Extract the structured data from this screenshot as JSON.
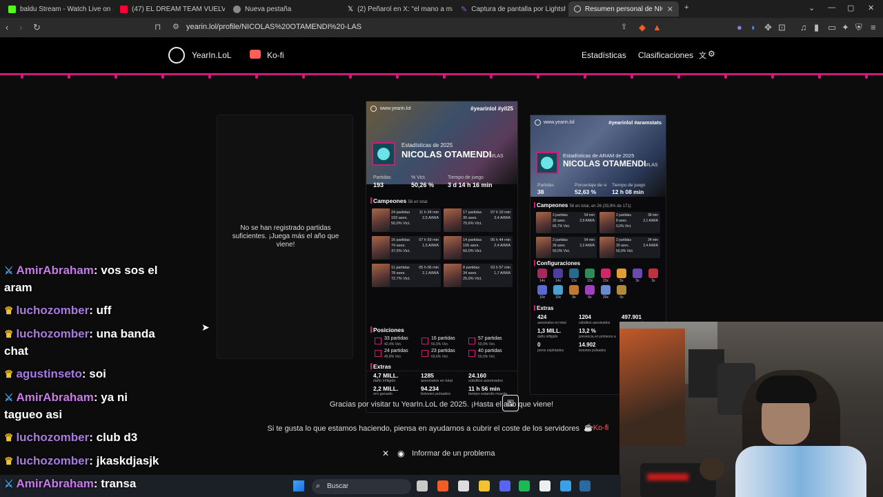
{
  "browser": {
    "tabs": [
      {
        "label": "baldu Stream - Watch Live on Ki",
        "favicon": "kick-icon",
        "color": "#53fc18"
      },
      {
        "label": "(47) EL DREAM TEAM VUELVE Y ALE",
        "favicon": "youtube-icon",
        "color": "#ff0033"
      },
      {
        "label": "Nueva pestaña",
        "favicon": "brave-icon",
        "color": "#999999"
      },
      {
        "label": "(2) Peñarol en X: \"el mano a mano",
        "favicon": "x-icon",
        "color": "#ffffff"
      },
      {
        "label": "Captura de pantalla por Lightshot",
        "favicon": "lightshot-icon",
        "color": "#a155e8"
      },
      {
        "label": "Resumen personal de NICOLAS",
        "favicon": "yearin-icon",
        "color": "#dddddd"
      }
    ],
    "url": "yearin.lol/profile/NICOLAS%20OTAMENDI%20-LAS"
  },
  "site": {
    "brand": "YearIn.LoL",
    "kofi": "Ko-fi",
    "nav": [
      "Estadísticas",
      "Clasificaciones"
    ],
    "empty_card_text": "No se han registrado partidas suficientes. ¡Juega más el año que viene!",
    "card1": {
      "site": "www.yearin.lol",
      "tags": "#yearinlol #yil25",
      "subtitle": "Estadísticas de 2025",
      "name": "NICOLAS OTAMENDI",
      "region": "#LAS",
      "stats": [
        {
          "label": "Partidas",
          "value": "193"
        },
        {
          "label": "% Vict.",
          "value": "50,26 %"
        },
        {
          "label": "Tiempo de juego",
          "value": "3 d 14 h 16 min"
        }
      ],
      "champions_title": "Campeones",
      "champions_note": "58 en total",
      "champions": [
        {
          "a": "24 partidas",
          "b": "193 ases.",
          "c": "50,0% Vict.",
          "d": "11 h 24 min",
          "e": "2,5 A/M/A"
        },
        {
          "a": "17 partidas",
          "b": "30 ases.",
          "c": "70,6% Vict.",
          "d": "07 h 10 min",
          "e": "3,4 A/M/A"
        },
        {
          "a": "16 partidas",
          "b": "74 ases.",
          "c": "37,5% Vict.",
          "d": "07 h 59 min",
          "e": "1,5 A/M/A"
        },
        {
          "a": "14 partidas",
          "b": "106 ases.",
          "c": "50,0% Vict.",
          "d": "06 h 44 min",
          "e": "2,4 A/M/A"
        },
        {
          "a": "11 partidas",
          "b": "78 ases.",
          "c": "72,7% Vict.",
          "d": "05 h 06 min",
          "e": "2,1 A/M/A"
        },
        {
          "a": "8 partidas",
          "b": "34 ases.",
          "c": "25,0% Vict.",
          "d": "03 h 57 min",
          "e": "1,7 A/M/A"
        }
      ],
      "positions_title": "Posiciones",
      "positions": [
        {
          "a": "33 partidas",
          "b": "42,4% Vict."
        },
        {
          "a": "16 partidas",
          "b": "50,0% Vict."
        },
        {
          "a": "57 partidas",
          "b": "50,9% Vict."
        },
        {
          "a": "24 partidas",
          "b": "45,8% Vict."
        },
        {
          "a": "23 partidas",
          "b": "69,6% Vict."
        },
        {
          "a": "40 partidas",
          "b": "50,0% Vict."
        }
      ],
      "extras_title": "Extras",
      "extras": [
        {
          "value": "4,7 MILL.",
          "label": "daño infligido"
        },
        {
          "value": "1285",
          "label": "asesinatos en total"
        },
        {
          "value": "24.160",
          "label": "súbditos asesinados"
        },
        {
          "value": "2,2 MILL.",
          "label": "oro ganado"
        },
        {
          "value": "94.234",
          "label": "botones pulsados"
        },
        {
          "value": "11 h 56 min",
          "label": "tiempo estando muerto"
        }
      ]
    },
    "card2": {
      "site": "www.yearin.lol",
      "tags": "#yearinlol #aramstats",
      "subtitle": "Estadísticas de ARAM de 2025",
      "name": "NICOLAS OTAMENDI",
      "region": "#LAS",
      "stats": [
        {
          "label": "Partidas",
          "value": "38"
        },
        {
          "label": "Porcentaje de vi",
          "value": "52,63 %"
        },
        {
          "label": "Tiempo de juego",
          "value": "12 h 08 min"
        }
      ],
      "champions_title": "Campeones",
      "champions_note": "58 en total, en 26 (33,9% de 171)",
      "champions": [
        {
          "a": "3 partidas",
          "b": "30 ases.",
          "c": "66,7% Vict.",
          "d": "54 min",
          "e": "2,9 A/M/A"
        },
        {
          "a": "2 partidas",
          "b": "8 ases.",
          "c": "0,0% Vict.",
          "d": "38 min",
          "e": "2,1 A/M/A"
        },
        {
          "a": "2 partidas",
          "b": "39 ases.",
          "c": "50,0% Vict.",
          "d": "54 min",
          "e": "2,2 A/M/A"
        },
        {
          "a": "2 partidas",
          "b": "30 ases.",
          "c": "50,0% Vict.",
          "d": "34 min",
          "e": "2,4 A/M/A"
        }
      ],
      "config_title": "Configuraciones",
      "configs": [
        "14x",
        "14x",
        "13x",
        "12x",
        "23x",
        "5x",
        "3x",
        "3x",
        "10x",
        "10x",
        "9x",
        "6x",
        "20x",
        "0x"
      ],
      "extras_title": "Extras",
      "extras": [
        {
          "value": "424",
          "label": "asesinatos en total"
        },
        {
          "value": "1204",
          "label": "súbditos asesinados"
        },
        {
          "value": "497.901",
          "label": "oro conseguido"
        },
        {
          "value": "1,3 MILL.",
          "label": "daño infligido"
        },
        {
          "value": "13,2 %",
          "label": "presencia en primeros a"
        },
        {
          "value": "0",
          "label": "poros explotados"
        },
        {
          "value": "14.902",
          "label": "botones pulsados"
        }
      ]
    },
    "thanks": "Gracias por visitar tu YearIn.LoL de 2025. ¡Hasta el año que viene!",
    "support": "Si te gusta lo que estamos haciendo, piensa en ayudarnos a cubrir el coste de los servidores",
    "report": "Informar de un problema"
  },
  "chat": [
    {
      "user": "AmirAbraham",
      "text": " vos sos el",
      "cont": "aram",
      "badge": "sword"
    },
    {
      "user": "luchozomber",
      "text": " uff",
      "badge": "crown"
    },
    {
      "user": "luchozomber",
      "text": " una banda",
      "cont": "chat",
      "badge": "crown"
    },
    {
      "user": "agustinseto",
      "text": " soi",
      "badge": "crown"
    },
    {
      "user": "AmirAbraham",
      "text": " ya ni",
      "cont": "tagueo asi",
      "badge": "sword"
    },
    {
      "user": "luchozomber",
      "text": " club d3",
      "badge": "crown"
    },
    {
      "user": "luchozomber",
      "text": " jkaskdjasjk",
      "badge": "crown"
    },
    {
      "user": "AmirAbraham",
      "text": " transa",
      "badge": "sword"
    }
  ],
  "taskbar": {
    "search": "Buscar"
  }
}
